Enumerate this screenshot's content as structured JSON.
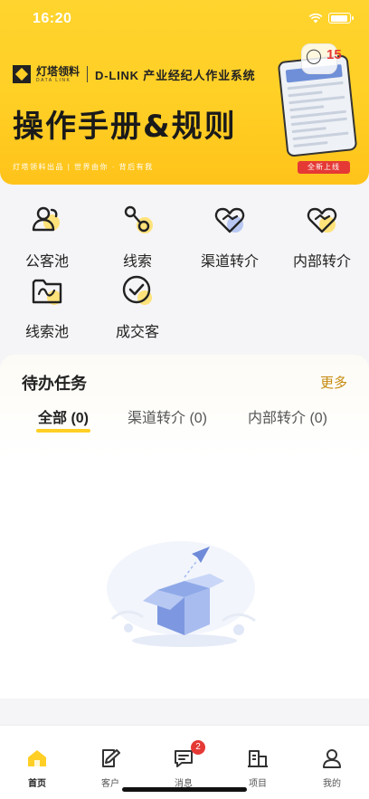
{
  "status_bar": {
    "time": "16:20"
  },
  "banner": {
    "logo_cn": "灯塔领料",
    "logo_en": "DATA LINK",
    "system_name": "D-LINK 产业经纪人作业系统",
    "title": "操作手册&规则",
    "subtitle": "灯塔领料出品 | 世界由你 · 背后有我",
    "bubble_count": "15",
    "launch_badge": "全新上线"
  },
  "quick_menu": [
    {
      "label": "公客池",
      "icon": "public-clients-icon"
    },
    {
      "label": "线索",
      "icon": "leads-icon"
    },
    {
      "label": "渠道转介",
      "icon": "channel-referral-icon"
    },
    {
      "label": "内部转介",
      "icon": "internal-referral-icon"
    },
    {
      "label": "线索池",
      "icon": "leads-pool-icon"
    },
    {
      "label": "成交客",
      "icon": "closed-client-icon"
    }
  ],
  "tasks": {
    "title": "待办任务",
    "more": "更多",
    "tabs": [
      {
        "label": "全部 (0)"
      },
      {
        "label": "渠道转介 (0)"
      },
      {
        "label": "内部转介 (0)"
      }
    ]
  },
  "tabbar": {
    "items": [
      {
        "label": "首页",
        "icon": "home-icon",
        "active": true
      },
      {
        "label": "客户",
        "icon": "customer-icon"
      },
      {
        "label": "消息",
        "icon": "message-icon",
        "badge": "2"
      },
      {
        "label": "项目",
        "icon": "project-icon"
      },
      {
        "label": "我的",
        "icon": "profile-icon"
      }
    ]
  },
  "colors": {
    "accent": "#ffcf25",
    "badge": "#e53935",
    "more_link": "#c58a0f"
  }
}
